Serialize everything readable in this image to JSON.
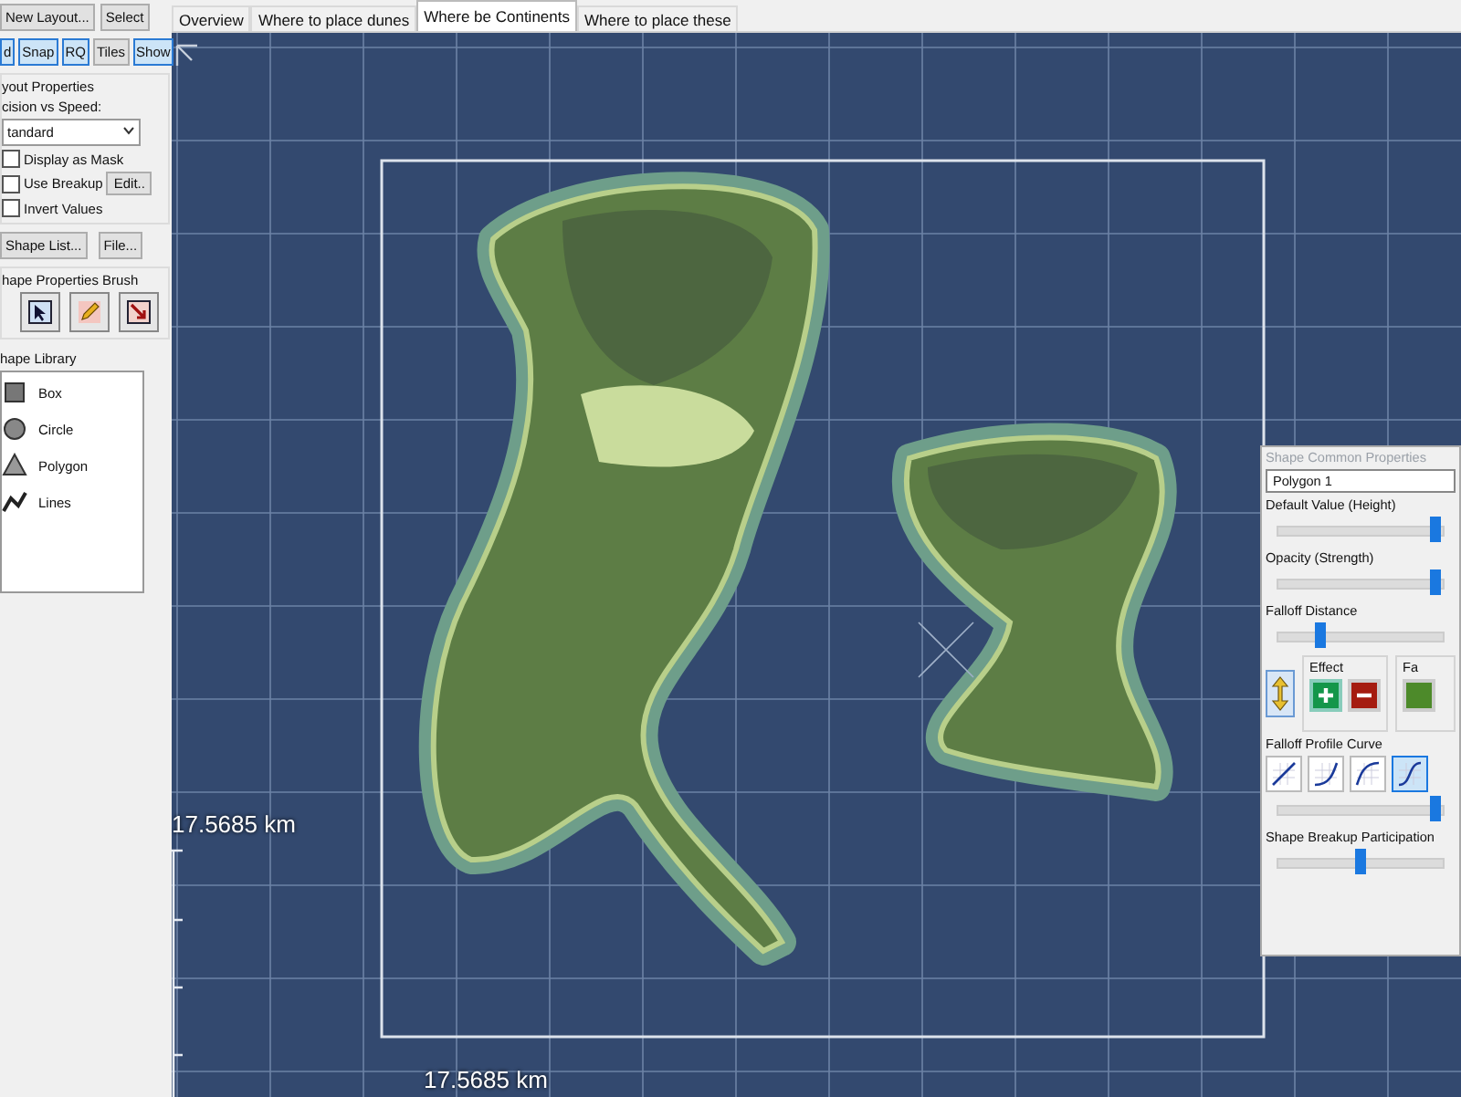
{
  "left_panel": {
    "top_buttons": [
      "New Layout...",
      "Select"
    ],
    "toggles": [
      {
        "label": "d",
        "selected": true
      },
      {
        "label": "Snap",
        "selected": true
      },
      {
        "label": "RQ",
        "selected": true
      },
      {
        "label": "Tiles",
        "selected": false
      },
      {
        "label": "Show",
        "selected": true
      }
    ],
    "layout_properties": {
      "title": "yout Properties",
      "quality_label": "cision vs Speed:",
      "quality_value": "tandard",
      "options": [
        {
          "label": "Display as Mask",
          "checked": false
        },
        {
          "label": "Use Breakup",
          "checked": false,
          "button": "Edit.."
        },
        {
          "label": "Invert Values",
          "checked": false
        }
      ]
    },
    "list_buttons": [
      "Shape List...",
      "File..."
    ],
    "brush": {
      "title": "hape Properties Brush",
      "tools": [
        {
          "kind": "pointer"
        },
        {
          "kind": "pencil"
        },
        {
          "kind": "eraser"
        }
      ]
    },
    "library": {
      "title": "hape Library",
      "items": [
        {
          "kind": "box",
          "label": "Box"
        },
        {
          "kind": "circle",
          "label": "Circle"
        },
        {
          "kind": "polygon",
          "label": "Polygon"
        },
        {
          "kind": "lines",
          "label": "Lines"
        }
      ]
    }
  },
  "tabs": [
    {
      "label": "Overview",
      "selected": false
    },
    {
      "label": "Where to place dunes",
      "selected": false
    },
    {
      "label": "Where be Continents",
      "selected": true
    },
    {
      "label": "Where to place these",
      "selected": false
    }
  ],
  "map": {
    "vertical_scale": "17.5685 km",
    "horizontal_scale": "17.5685 km"
  },
  "properties_panel": {
    "title": "Shape Common Properties",
    "shape": "Polygon 1",
    "sliders": [
      {
        "label": "Default Value (Height)",
        "level": 0.95
      },
      {
        "label": "Opacity (Strength)",
        "level": 0.95
      },
      {
        "label": "Falloff Distance",
        "level": 0.25
      }
    ],
    "effect": {
      "title": "Effect",
      "buttons": [
        {
          "kind": "plus",
          "selected": true
        },
        {
          "kind": "minus",
          "selected": false
        }
      ]
    },
    "falloff_group": {
      "title": "Fa"
    },
    "profile": {
      "title": "Falloff Profile Curve",
      "curves": [
        {
          "kind": "linear",
          "selected": false
        },
        {
          "kind": "ease-in",
          "selected": false
        },
        {
          "kind": "ease-out",
          "selected": false
        },
        {
          "kind": "s-curve",
          "selected": true
        }
      ],
      "level": 0.95
    },
    "breakup": {
      "title": "Shape Breakup Participation",
      "level": 0.5
    }
  }
}
